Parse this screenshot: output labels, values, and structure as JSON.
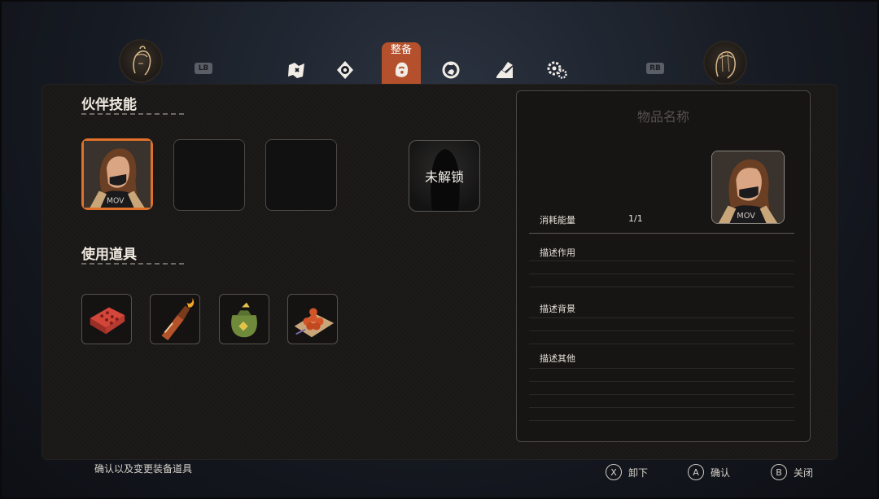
{
  "nav": {
    "lb_label": "LB",
    "rb_label": "RB",
    "active_tab_label": "整备",
    "tabs": [
      {
        "icon": "map-icon"
      },
      {
        "icon": "eye-compass-icon"
      },
      {
        "icon": "companion-face-icon",
        "label": "整备"
      },
      {
        "icon": "hand-ring-icon"
      },
      {
        "icon": "crafting-icon"
      },
      {
        "icon": "settings-gears-icon"
      }
    ]
  },
  "skills": {
    "title": "伙伴技能",
    "locked_label": "未解锁"
  },
  "items": {
    "title": "使用道具",
    "list": [
      {
        "icon": "brick-icon"
      },
      {
        "icon": "molotov-icon"
      },
      {
        "icon": "herb-bag-icon"
      },
      {
        "icon": "fruit-tray-icon"
      }
    ]
  },
  "detail": {
    "item_name": "物品名称",
    "energy_label": "消耗能量",
    "energy_value": "1/1",
    "desc_effect": "描述作用",
    "desc_background": "描述背景",
    "desc_other": "描述其他"
  },
  "footer": {
    "hint": "确认以及变更装备道具",
    "actions": [
      {
        "key": "X",
        "label": "卸下"
      },
      {
        "key": "A",
        "label": "确认"
      },
      {
        "key": "B",
        "label": "关闭"
      }
    ]
  },
  "colors": {
    "accent": "#b4502c",
    "selection": "#e0712a"
  }
}
